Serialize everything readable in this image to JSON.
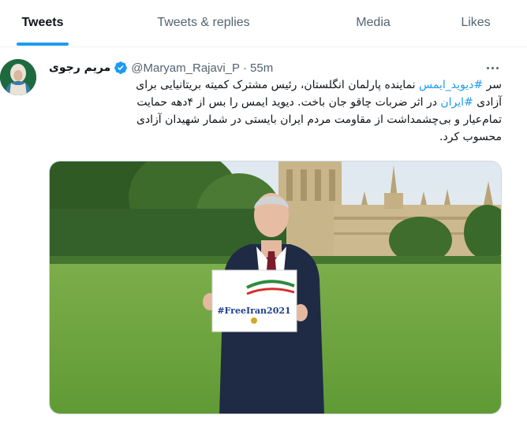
{
  "tabs": [
    {
      "label": "Tweets",
      "active": true
    },
    {
      "label": "Tweets & replies",
      "active": false
    },
    {
      "label": "Media",
      "active": false
    },
    {
      "label": "Likes",
      "active": false
    }
  ],
  "tweet": {
    "author_name": "مریم رجوی",
    "handle": "@Maryam_Rajavi_P",
    "separator": "·",
    "time": "55m",
    "verified": true,
    "text": {
      "line1_pre": "سر ",
      "line1_link": "#دیوید_ایمس",
      "line1_post": " نماینده پارلمان انگلستان، رئیس مشترک کمیته بریتانیایی برای",
      "line2_pre": "آزادی ",
      "line2_link": "#ایران",
      "line2_post": " در اثر ضربات چاقو جان باخت. دیوید ایمس را بس از ۴دهه حمایت",
      "line3": "تمام‌عیار و بی‌چشمداشت از مقاومت مردم ایران بایستی در شمار شهیدان آزادی",
      "line4": "محسوب کرد."
    },
    "media": {
      "sign_text": "#FreeIran2021"
    }
  },
  "colors": {
    "accent": "#1d9bf0",
    "text_primary": "#0f1419",
    "text_secondary": "#536471"
  },
  "icons": {
    "verified": "verified-badge-icon",
    "more": "more-dots-icon"
  }
}
